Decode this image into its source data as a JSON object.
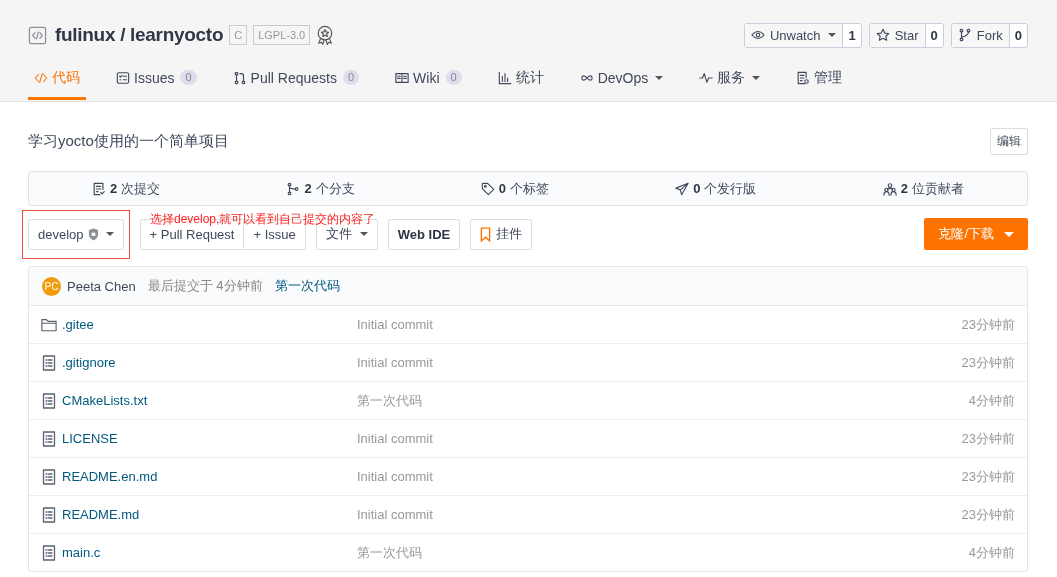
{
  "repo": {
    "owner": "fulinux",
    "separator": "/",
    "name": "learnyocto",
    "badges": [
      "C",
      "LGPL-3.0"
    ]
  },
  "actions": [
    {
      "kind": "watch",
      "label": "Unwatch",
      "caret": true,
      "count": "1"
    },
    {
      "kind": "star",
      "label": "Star",
      "caret": false,
      "count": "0"
    },
    {
      "kind": "fork",
      "label": "Fork",
      "caret": false,
      "count": "0"
    }
  ],
  "tabs": [
    {
      "kind": "code",
      "label": "代码",
      "selected": true
    },
    {
      "kind": "issues",
      "label": "Issues",
      "count": "0",
      "selected": false
    },
    {
      "kind": "pr",
      "label": "Pull Requests",
      "count": "0",
      "selected": false
    },
    {
      "kind": "wiki",
      "label": "Wiki",
      "count": "0",
      "selected": false
    },
    {
      "kind": "stats",
      "label": "统计",
      "selected": false
    },
    {
      "kind": "devops",
      "label": "DevOps",
      "caret": true,
      "selected": false
    },
    {
      "kind": "service",
      "label": "服务",
      "caret": true,
      "selected": false
    },
    {
      "kind": "manage",
      "label": "管理",
      "selected": false
    }
  ],
  "description": "学习yocto使用的一个简单项目",
  "edit_button": "编辑",
  "stats": [
    {
      "kind": "commits",
      "count": "2",
      "label": "次提交"
    },
    {
      "kind": "branches",
      "count": "2",
      "label": "个分支"
    },
    {
      "kind": "tags",
      "count": "0",
      "label": "个标签"
    },
    {
      "kind": "releases",
      "count": "0",
      "label": "个发行版"
    },
    {
      "kind": "contributors",
      "count": "2",
      "label": "位贡献者"
    }
  ],
  "branch": "develop",
  "annotation": "选择develop,就可以看到自己提交的内容了",
  "toolbar": [
    {
      "kind": "pr",
      "label": "+ Pull Request"
    },
    {
      "kind": "issue",
      "label": "+ Issue"
    },
    {
      "kind": "files",
      "label": "文件"
    },
    {
      "kind": "webide",
      "label": "Web IDE"
    },
    {
      "kind": "widget",
      "label": "挂件"
    }
  ],
  "clone_button": "克隆/下载",
  "last_commit": {
    "avatar": "PC",
    "author": "Peeta Chen",
    "time": "最后提交于 4分钟前",
    "message": "第一次代码"
  },
  "files": [
    {
      "kind": "folder",
      "name": ".gitee",
      "message": "Initial commit",
      "time": "23分钟前"
    },
    {
      "kind": "file",
      "name": ".gitignore",
      "message": "Initial commit",
      "time": "23分钟前"
    },
    {
      "kind": "file",
      "name": "CMakeLists.txt",
      "message": "第一次代码",
      "time": "4分钟前"
    },
    {
      "kind": "file",
      "name": "LICENSE",
      "message": "Initial commit",
      "time": "23分钟前"
    },
    {
      "kind": "file",
      "name": "README.en.md",
      "message": "Initial commit",
      "time": "23分钟前"
    },
    {
      "kind": "file",
      "name": "README.md",
      "message": "Initial commit",
      "time": "23分钟前"
    },
    {
      "kind": "file",
      "name": "main.c",
      "message": "第一次代码",
      "time": "4分钟前"
    }
  ]
}
